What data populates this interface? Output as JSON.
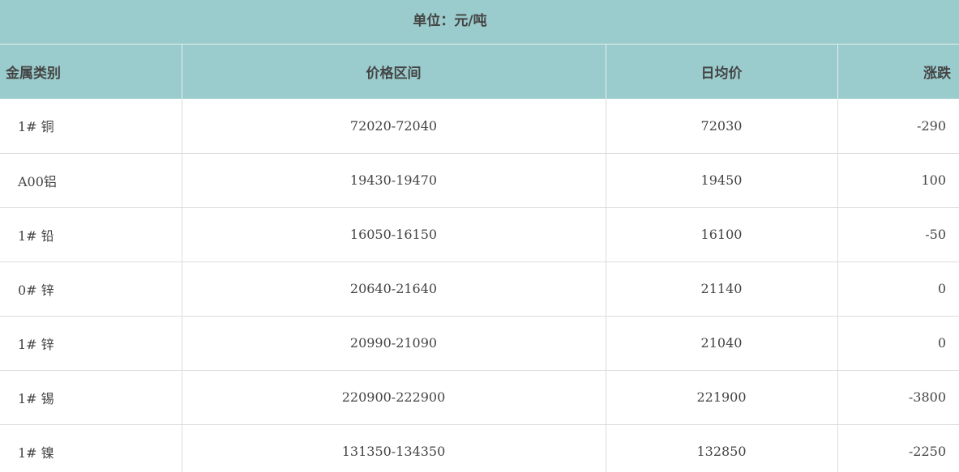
{
  "unit_label": "单位：元/吨",
  "table": {
    "headers": {
      "metal": "金属类别",
      "range": "价格区间",
      "avg": "日均价",
      "change": "涨跌"
    },
    "rows": [
      {
        "metal": "1# 铜",
        "range": "72020-72040",
        "avg": "72030",
        "change": "-290"
      },
      {
        "metal": "A00铝",
        "range": "19430-19470",
        "avg": "19450",
        "change": "100"
      },
      {
        "metal": "1# 铅",
        "range": "16050-16150",
        "avg": "16100",
        "change": "-50"
      },
      {
        "metal": "0# 锌",
        "range": "20640-21640",
        "avg": "21140",
        "change": "0"
      },
      {
        "metal": "1# 锌",
        "range": "20990-21090",
        "avg": "21040",
        "change": "0"
      },
      {
        "metal": "1# 锡",
        "range": "220900-222900",
        "avg": "221900",
        "change": "-3800"
      },
      {
        "metal": "1# 镍",
        "range": "131350-134350",
        "avg": "132850",
        "change": "-2250"
      }
    ]
  },
  "colors": {
    "header_bg": "#9bcccd",
    "text": "#444444",
    "grid": "#dcdcdc"
  }
}
